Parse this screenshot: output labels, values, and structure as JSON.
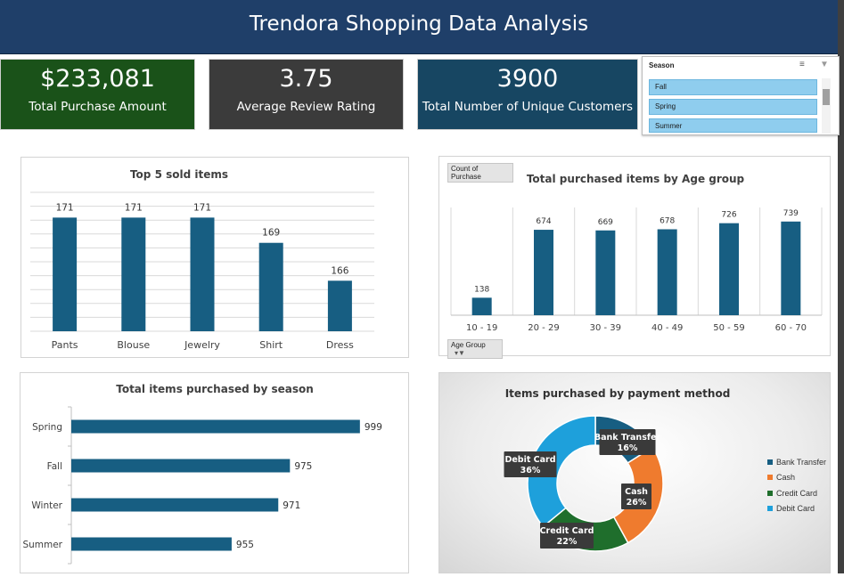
{
  "header": {
    "title": "Trendora Shopping Data Analysis"
  },
  "kpis": [
    {
      "value": "$233,081",
      "label": "Total Purchase Amount",
      "color": "#1a5219"
    },
    {
      "value": "3.75",
      "label": "Average Review Rating",
      "color": "#3b3b3b"
    },
    {
      "value": "3900",
      "label": "Total Number of Unique Customers",
      "color": "#174662"
    }
  ],
  "slicer": {
    "title": "Season",
    "multi_select_icon": "multi-select-icon",
    "clear_filter_icon": "clear-filter-icon",
    "items": [
      "Fall",
      "Spring",
      "Summer"
    ]
  },
  "colors": {
    "bar": "#175e82",
    "bank_transfer": "#175e82",
    "cash": "#ef7b2e",
    "credit_card": "#1f6e2c",
    "debit_card": "#1ea0db"
  },
  "chart_data": [
    {
      "id": "top-items",
      "type": "bar",
      "title": "Top 5 sold items",
      "categories": [
        "Pants",
        "Blouse",
        "Jewelry",
        "Shirt",
        "Dress"
      ],
      "values": [
        171,
        171,
        171,
        169,
        166
      ],
      "ylim": [
        162,
        173
      ],
      "grid": true
    },
    {
      "id": "age-group",
      "type": "bar",
      "title": "Total purchased items by Age group",
      "field_button": "Count of Purchase",
      "axis_button": "Age Group",
      "categories": [
        "10 - 19",
        "20 - 29",
        "30 - 39",
        "40 - 49",
        "50 - 59",
        "60 - 70"
      ],
      "values": [
        138,
        674,
        669,
        678,
        726,
        739
      ],
      "ylim": [
        0,
        850
      ],
      "grid": true
    },
    {
      "id": "season",
      "type": "bar",
      "orientation": "horizontal",
      "title": "Total items purchased by season",
      "categories": [
        "Spring",
        "Fall",
        "Winter",
        "Summer"
      ],
      "values": [
        999,
        975,
        971,
        955
      ],
      "xlim": [
        900,
        1007
      ]
    },
    {
      "id": "payment",
      "type": "pie",
      "donut": true,
      "title": "Items purchased by payment method",
      "slices": [
        {
          "name": "Bank Transfer",
          "percent": 16,
          "label": "16%"
        },
        {
          "name": "Cash",
          "percent": 26,
          "label": "26%"
        },
        {
          "name": "Credit Card",
          "percent": 22,
          "label": "22%"
        },
        {
          "name": "Debit Card",
          "percent": 36,
          "label": "36%"
        }
      ],
      "legend": "right"
    }
  ]
}
